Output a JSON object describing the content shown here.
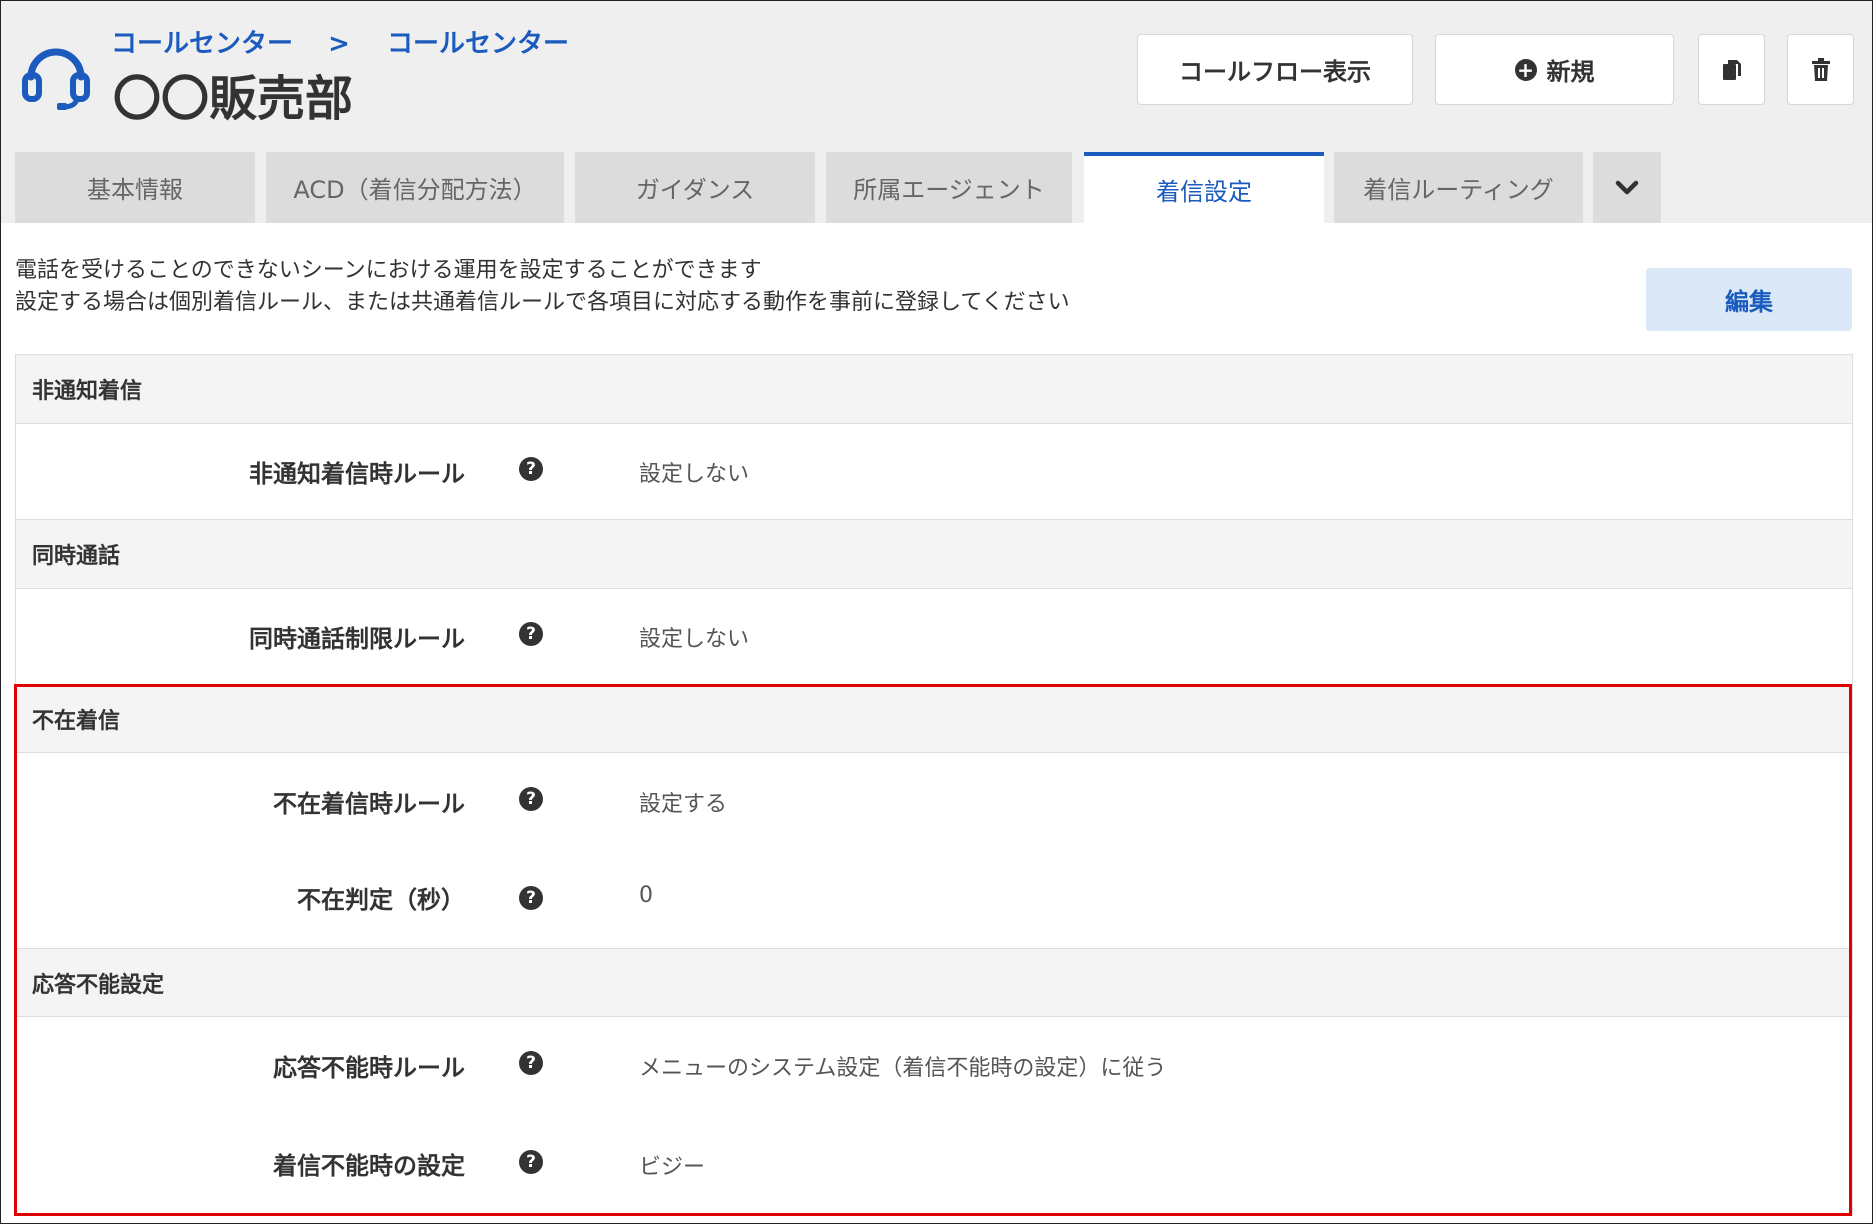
{
  "breadcrumb": {
    "items": [
      "コールセンター",
      "コールセンター"
    ],
    "separator": ">"
  },
  "page_title": "〇〇販売部",
  "toolbar": {
    "callflow_label": "コールフロー表示",
    "new_label": "新規"
  },
  "tabs": [
    {
      "label": "基本情報",
      "active": false
    },
    {
      "label": "ACD（着信分配方法）",
      "active": false
    },
    {
      "label": "ガイダンス",
      "active": false
    },
    {
      "label": "所属エージェント",
      "active": false
    },
    {
      "label": "着信設定",
      "active": true
    },
    {
      "label": "着信ルーティング",
      "active": false
    }
  ],
  "description": {
    "line1": "電話を受けることのできないシーンにおける運用を設定することができます",
    "line2": "設定する場合は個別着信ルール、または共通着信ルールで各項目に対応する動作を事前に登録してください"
  },
  "edit_label": "編集",
  "sections": [
    {
      "title": "非通知着信",
      "rows": [
        {
          "label": "非通知着信時ルール",
          "value": "設定しない"
        }
      ]
    },
    {
      "title": "同時通話",
      "rows": [
        {
          "label": "同時通話制限ルール",
          "value": "設定しない"
        }
      ]
    },
    {
      "title": "不在着信",
      "rows": [
        {
          "label": "不在着信時ルール",
          "value": "設定する"
        },
        {
          "label": "不在判定（秒）",
          "value": "0"
        }
      ]
    },
    {
      "title": "応答不能設定",
      "rows": [
        {
          "label": "応答不能時ルール",
          "value": "メニューのシステム設定（着信不能時の設定）に従う"
        },
        {
          "label": "着信不能時の設定",
          "value": "ビジー"
        }
      ]
    }
  ],
  "colors": {
    "accent": "#1a5bbd",
    "highlight_border": "#e00000",
    "header_bg": "#efefef"
  }
}
